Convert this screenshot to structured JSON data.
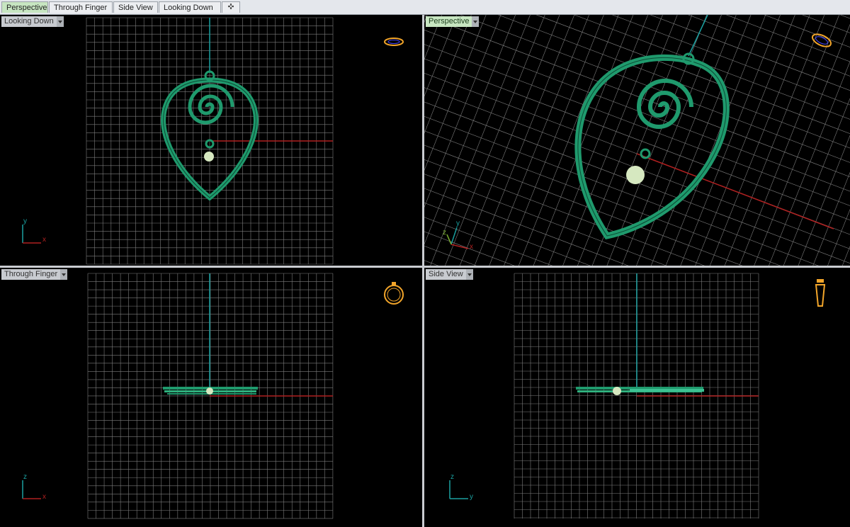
{
  "tabs": [
    {
      "label": "Perspective",
      "active": true
    },
    {
      "label": "Through Finger",
      "active": false
    },
    {
      "label": "Side View",
      "active": false
    },
    {
      "label": "Looking Down",
      "active": false
    }
  ],
  "viewports": {
    "top_left": {
      "label": "Looking Down",
      "axis_h": "x",
      "axis_v": "y"
    },
    "top_right": {
      "label": "Perspective",
      "axis_h": "x",
      "axis_v": "y",
      "axis_z": "z"
    },
    "bottom_left": {
      "label": "Through Finger",
      "axis_h": "x",
      "axis_v": "z"
    },
    "bottom_right": {
      "label": "Side View",
      "axis_h": "y",
      "axis_v": "z"
    }
  },
  "colors": {
    "viewport_bg": "#000000",
    "grid": "#7d7d7d",
    "x_axis": "#b02020",
    "y_axis": "#1aa0a0",
    "model": "#1f9a6d",
    "pearl": "#d6e8c0",
    "nav_icon": "#f2a52a",
    "active_label": "#c7e6c1"
  },
  "icons": {
    "tab_add": "plus-tab-icon",
    "ring_top": "ring-top-view-icon",
    "ring_front": "ring-front-view-icon",
    "ring_side": "ring-side-view-icon",
    "ring_perspective": "ring-perspective-icon"
  }
}
